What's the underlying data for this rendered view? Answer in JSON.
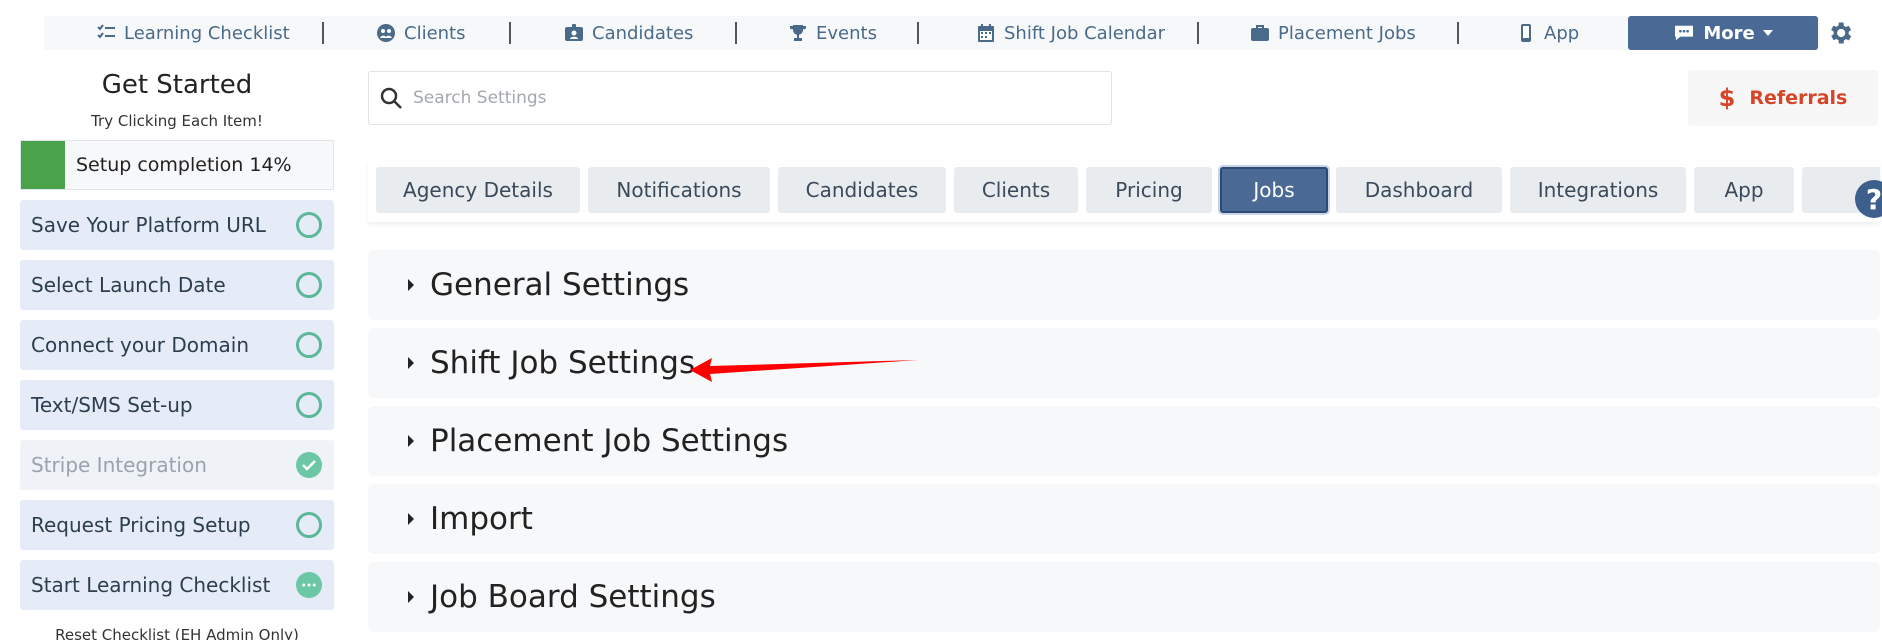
{
  "topnav": {
    "items": [
      {
        "label": "Learning Checklist",
        "icon": "checklist-icon"
      },
      {
        "label": "Clients",
        "icon": "clients-icon"
      },
      {
        "label": "Candidates",
        "icon": "id-badge-icon"
      },
      {
        "label": "Events",
        "icon": "trophy-icon"
      },
      {
        "label": "Shift Job Calendar",
        "icon": "calendar-icon"
      },
      {
        "label": "Placement Jobs",
        "icon": "briefcase-icon"
      },
      {
        "label": "App",
        "icon": "mobile-icon"
      }
    ],
    "more_label": "More"
  },
  "sidebar": {
    "title": "Get Started",
    "subtitle": "Try Clicking Each Item!",
    "progress_label": "Setup completion 14%",
    "progress_value": 0.14,
    "items": [
      {
        "label": "Save Your Platform URL",
        "status": "todo"
      },
      {
        "label": "Select Launch Date",
        "status": "todo"
      },
      {
        "label": "Connect your Domain",
        "status": "todo"
      },
      {
        "label": "Text/SMS Set-up",
        "status": "todo"
      },
      {
        "label": "Stripe Integration",
        "status": "done"
      },
      {
        "label": "Request Pricing Setup",
        "status": "todo"
      },
      {
        "label": "Start Learning Checklist",
        "status": "in-progress"
      }
    ],
    "reset_label": "Reset Checklist (EH Admin Only)"
  },
  "search": {
    "placeholder": "Search Settings"
  },
  "referrals": {
    "label": "Referrals",
    "icon": "dollar-icon",
    "color": "#d64528"
  },
  "tabs": [
    {
      "label": "Agency Details"
    },
    {
      "label": "Notifications"
    },
    {
      "label": "Candidates"
    },
    {
      "label": "Clients"
    },
    {
      "label": "Pricing"
    },
    {
      "label": "Jobs",
      "active": true
    },
    {
      "label": "Dashboard"
    },
    {
      "label": "Integrations"
    },
    {
      "label": "App"
    }
  ],
  "sections": [
    {
      "title": "General Settings"
    },
    {
      "title": "Shift Job Settings"
    },
    {
      "title": "Placement Job Settings"
    },
    {
      "title": "Import"
    },
    {
      "title": "Job Board Settings"
    }
  ],
  "colors": {
    "accent": "#4a6a95",
    "success": "#4aa34a",
    "annotation_arrow": "#ff0000"
  }
}
